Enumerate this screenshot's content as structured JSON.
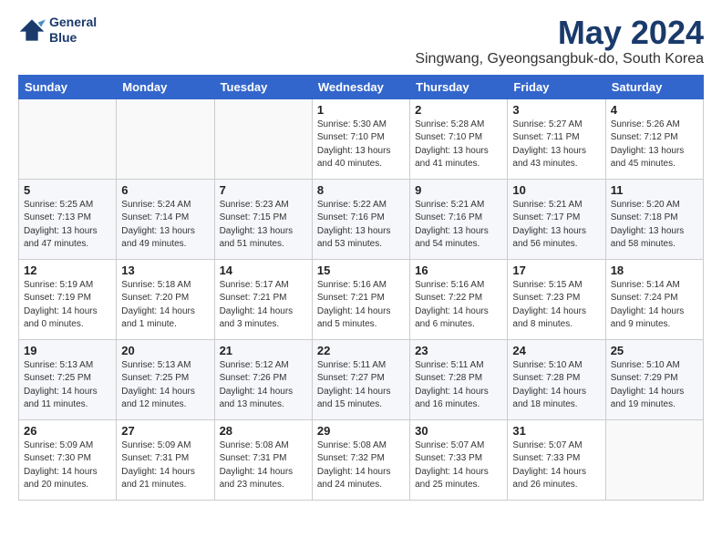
{
  "logo": {
    "line1": "General",
    "line2": "Blue"
  },
  "title": "May 2024",
  "subtitle": "Singwang, Gyeongsangbuk-do, South Korea",
  "weekdays": [
    "Sunday",
    "Monday",
    "Tuesday",
    "Wednesday",
    "Thursday",
    "Friday",
    "Saturday"
  ],
  "weeks": [
    [
      {
        "day": "",
        "info": ""
      },
      {
        "day": "",
        "info": ""
      },
      {
        "day": "",
        "info": ""
      },
      {
        "day": "1",
        "info": "Sunrise: 5:30 AM\nSunset: 7:10 PM\nDaylight: 13 hours\nand 40 minutes."
      },
      {
        "day": "2",
        "info": "Sunrise: 5:28 AM\nSunset: 7:10 PM\nDaylight: 13 hours\nand 41 minutes."
      },
      {
        "day": "3",
        "info": "Sunrise: 5:27 AM\nSunset: 7:11 PM\nDaylight: 13 hours\nand 43 minutes."
      },
      {
        "day": "4",
        "info": "Sunrise: 5:26 AM\nSunset: 7:12 PM\nDaylight: 13 hours\nand 45 minutes."
      }
    ],
    [
      {
        "day": "5",
        "info": "Sunrise: 5:25 AM\nSunset: 7:13 PM\nDaylight: 13 hours\nand 47 minutes."
      },
      {
        "day": "6",
        "info": "Sunrise: 5:24 AM\nSunset: 7:14 PM\nDaylight: 13 hours\nand 49 minutes."
      },
      {
        "day": "7",
        "info": "Sunrise: 5:23 AM\nSunset: 7:15 PM\nDaylight: 13 hours\nand 51 minutes."
      },
      {
        "day": "8",
        "info": "Sunrise: 5:22 AM\nSunset: 7:16 PM\nDaylight: 13 hours\nand 53 minutes."
      },
      {
        "day": "9",
        "info": "Sunrise: 5:21 AM\nSunset: 7:16 PM\nDaylight: 13 hours\nand 54 minutes."
      },
      {
        "day": "10",
        "info": "Sunrise: 5:21 AM\nSunset: 7:17 PM\nDaylight: 13 hours\nand 56 minutes."
      },
      {
        "day": "11",
        "info": "Sunrise: 5:20 AM\nSunset: 7:18 PM\nDaylight: 13 hours\nand 58 minutes."
      }
    ],
    [
      {
        "day": "12",
        "info": "Sunrise: 5:19 AM\nSunset: 7:19 PM\nDaylight: 14 hours\nand 0 minutes."
      },
      {
        "day": "13",
        "info": "Sunrise: 5:18 AM\nSunset: 7:20 PM\nDaylight: 14 hours\nand 1 minute."
      },
      {
        "day": "14",
        "info": "Sunrise: 5:17 AM\nSunset: 7:21 PM\nDaylight: 14 hours\nand 3 minutes."
      },
      {
        "day": "15",
        "info": "Sunrise: 5:16 AM\nSunset: 7:21 PM\nDaylight: 14 hours\nand 5 minutes."
      },
      {
        "day": "16",
        "info": "Sunrise: 5:16 AM\nSunset: 7:22 PM\nDaylight: 14 hours\nand 6 minutes."
      },
      {
        "day": "17",
        "info": "Sunrise: 5:15 AM\nSunset: 7:23 PM\nDaylight: 14 hours\nand 8 minutes."
      },
      {
        "day": "18",
        "info": "Sunrise: 5:14 AM\nSunset: 7:24 PM\nDaylight: 14 hours\nand 9 minutes."
      }
    ],
    [
      {
        "day": "19",
        "info": "Sunrise: 5:13 AM\nSunset: 7:25 PM\nDaylight: 14 hours\nand 11 minutes."
      },
      {
        "day": "20",
        "info": "Sunrise: 5:13 AM\nSunset: 7:25 PM\nDaylight: 14 hours\nand 12 minutes."
      },
      {
        "day": "21",
        "info": "Sunrise: 5:12 AM\nSunset: 7:26 PM\nDaylight: 14 hours\nand 13 minutes."
      },
      {
        "day": "22",
        "info": "Sunrise: 5:11 AM\nSunset: 7:27 PM\nDaylight: 14 hours\nand 15 minutes."
      },
      {
        "day": "23",
        "info": "Sunrise: 5:11 AM\nSunset: 7:28 PM\nDaylight: 14 hours\nand 16 minutes."
      },
      {
        "day": "24",
        "info": "Sunrise: 5:10 AM\nSunset: 7:28 PM\nDaylight: 14 hours\nand 18 minutes."
      },
      {
        "day": "25",
        "info": "Sunrise: 5:10 AM\nSunset: 7:29 PM\nDaylight: 14 hours\nand 19 minutes."
      }
    ],
    [
      {
        "day": "26",
        "info": "Sunrise: 5:09 AM\nSunset: 7:30 PM\nDaylight: 14 hours\nand 20 minutes."
      },
      {
        "day": "27",
        "info": "Sunrise: 5:09 AM\nSunset: 7:31 PM\nDaylight: 14 hours\nand 21 minutes."
      },
      {
        "day": "28",
        "info": "Sunrise: 5:08 AM\nSunset: 7:31 PM\nDaylight: 14 hours\nand 23 minutes."
      },
      {
        "day": "29",
        "info": "Sunrise: 5:08 AM\nSunset: 7:32 PM\nDaylight: 14 hours\nand 24 minutes."
      },
      {
        "day": "30",
        "info": "Sunrise: 5:07 AM\nSunset: 7:33 PM\nDaylight: 14 hours\nand 25 minutes."
      },
      {
        "day": "31",
        "info": "Sunrise: 5:07 AM\nSunset: 7:33 PM\nDaylight: 14 hours\nand 26 minutes."
      },
      {
        "day": "",
        "info": ""
      }
    ]
  ]
}
